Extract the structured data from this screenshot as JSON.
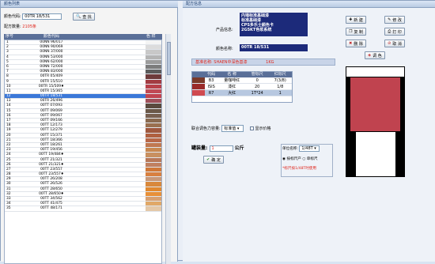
{
  "left_header": "颜色列表",
  "right_header": "配方信息",
  "search": {
    "label": "颜色代码:",
    "value": "00TR 18/531",
    "button": "查 找"
  },
  "count": {
    "label": "配方数量:",
    "value": "2105条"
  },
  "list": {
    "columns": [
      "序号",
      "颜色代码",
      "色 样"
    ],
    "rows": [
      {
        "n": "1",
        "code": "00NN 96/017",
        "sw": "#f4f4f4"
      },
      {
        "n": "2",
        "code": "00NN 90/069",
        "sw": "#dcdcdc"
      },
      {
        "n": "3",
        "code": "00NN 37/000",
        "sw": "#c8c8c8"
      },
      {
        "n": "4",
        "code": "00NN 53/000",
        "sw": "#b4b4b4"
      },
      {
        "n": "5",
        "code": "00NN 62/000",
        "sw": "#9c9c9c"
      },
      {
        "n": "6",
        "code": "00NN 72/000",
        "sw": "#7c7c7c"
      },
      {
        "n": "7",
        "code": "00NN 83/000",
        "sw": "#5c5c5c"
      },
      {
        "n": "8",
        "code": "00TR 05/409",
        "sw": "#6e3b3b"
      },
      {
        "n": "9",
        "code": "00TR 15/510",
        "sw": "#a33b42"
      },
      {
        "n": "10",
        "code": "00TR 15/509♦",
        "sw": "#b8404a"
      },
      {
        "n": "11",
        "code": "00TR 15/365",
        "sw": "#c04a55"
      },
      {
        "n": "12",
        "code": "00TR 18/531",
        "sw": "#c0434f",
        "sel": true
      },
      {
        "n": "13",
        "code": "00TR 26/496",
        "sw": "#a0505a"
      },
      {
        "n": "14",
        "code": "00TT 07/093",
        "sw": "#5a4a3e"
      },
      {
        "n": "15",
        "code": "00TT 09/069",
        "sw": "#6a5848"
      },
      {
        "n": "16",
        "code": "00TT 09/067",
        "sw": "#786050"
      },
      {
        "n": "17",
        "code": "00TT 09/166",
        "sw": "#8a6a50"
      },
      {
        "n": "18",
        "code": "00TT 12/173",
        "sw": "#9a7050"
      },
      {
        "n": "19",
        "code": "00TT 12/279",
        "sw": "#a0583e"
      },
      {
        "n": "20",
        "code": "00TT 15/371",
        "sw": "#b06040"
      },
      {
        "n": "21",
        "code": "00TT 18/366",
        "sw": "#b86848"
      },
      {
        "n": "22",
        "code": "00TT 18/261",
        "sw": "#c07850"
      },
      {
        "n": "23",
        "code": "00TT 19/456",
        "sw": "#c88850"
      },
      {
        "n": "24",
        "code": "00TT 19/484♦",
        "sw": "#c89060"
      },
      {
        "n": "25",
        "code": "00TT 21/321",
        "sw": "#b87858"
      },
      {
        "n": "26",
        "code": "00TT 21/321♦",
        "sw": "#c08060"
      },
      {
        "n": "27",
        "code": "00TT 23/557",
        "sw": "#d07838"
      },
      {
        "n": "28",
        "code": "00TT 23/557♦",
        "sw": "#d88040"
      },
      {
        "n": "29",
        "code": "00TT 26/208",
        "sw": "#c89878"
      },
      {
        "n": "30",
        "code": "00TT 26/526",
        "sw": "#d8883c"
      },
      {
        "n": "31",
        "code": "00TT 28/650",
        "sw": "#e08830"
      },
      {
        "n": "32",
        "code": "00TT 28/650♦",
        "sw": "#e89038"
      },
      {
        "n": "33",
        "code": "00TT 34/562",
        "sw": "#d8a070"
      },
      {
        "n": "34",
        "code": "00TT 41/475",
        "sw": "#e0a868"
      },
      {
        "n": "35",
        "code": "00TT 48/171",
        "sw": "#e4c8a8"
      }
    ]
  },
  "product": {
    "label": "产品信息:",
    "lines": [
      "内墙标准基础漆",
      "标准基础漆",
      "CPS多乐士颜色卡",
      "2G5KT色浆系统"
    ]
  },
  "color_name": {
    "label": "颜色名称:",
    "value": "00TR 18/531"
  },
  "std": {
    "label": "基准名称:",
    "value": "SHAEN中深色基漆",
    "extra": "1KG"
  },
  "colorant_table": {
    "columns": [
      "代码",
      "名 称",
      "管标尺",
      "红标尺"
    ],
    "rows": [
      {
        "sw": "#7a3a2a",
        "code": "B3",
        "name": "量咖啡红",
        "a": "0",
        "b": "7(3/8)"
      },
      {
        "sw": "#9a2a2a",
        "code": "ISIS",
        "name": "漆红",
        "a": "20",
        "b": "1/8"
      },
      {
        "sw": "#d04a50",
        "code": "R7",
        "name": "大红",
        "a": "1T*24",
        "b": "1"
      }
    ]
  },
  "remaining": {
    "label": "联合调色力容量:",
    "value": "标准值",
    "check_label": "显示价格"
  },
  "qty": {
    "label": "罐装量:",
    "value": "1",
    "unit": "公斤",
    "unit_select_label": "单位名称:",
    "unit_select": "1/48T",
    "radio1": "按标尺产",
    "radio2": "单标尺",
    "note": "*标尺按1/48T时使用",
    "confirm": "确 定"
  },
  "buttons": {
    "new": "新 建",
    "edit": "修 改",
    "copy": "复 制",
    "print": "打 印",
    "delete": "删 除",
    "cancel": "取 消",
    "color": "调 色"
  },
  "colors": {
    "navy": "#1c2a7a",
    "sample": "#c0434f",
    "selection": "#3b78d8"
  }
}
